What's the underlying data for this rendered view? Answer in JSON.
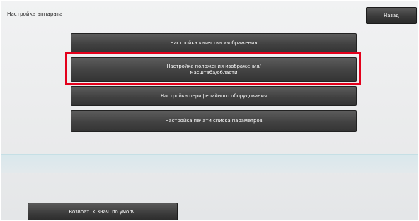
{
  "header": {
    "title": "Настройка аппарата",
    "back_label": "Назад"
  },
  "menu": {
    "items": [
      {
        "label": "Настройка качества изображения"
      },
      {
        "line1": "Настройка положения изображения/",
        "line2": "масштаба/области"
      },
      {
        "label": "Настройка периферийного оборудования"
      },
      {
        "label": "Настройка печати списка параметров"
      }
    ],
    "highlighted_index": 1
  },
  "footer": {
    "reset_label": "Возврат. к Знач. по умолч."
  },
  "colors": {
    "highlight": "#e3001b",
    "button": "#3a3a3a",
    "background": "#eceded"
  }
}
